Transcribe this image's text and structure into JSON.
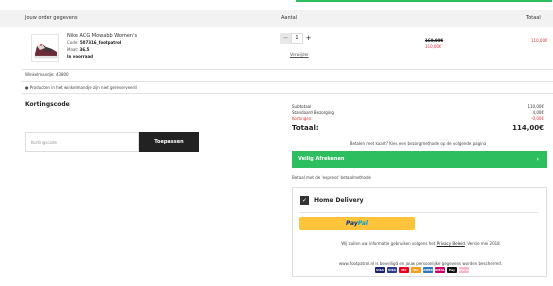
{
  "header": {
    "col_order": "Jouw order gegevens",
    "col_qty": "Aantal",
    "col_total": "Totaal"
  },
  "product": {
    "name": "Nike ACG Mowabb Women's",
    "code_label": "Code:",
    "code_value": "507316_footpatrol",
    "size_label": "Maat:",
    "size_value": "36.5",
    "stock": "In voorraad",
    "quantity": "1",
    "remove_label": "Verwijder",
    "price_old": "160,00€",
    "price_new": "110,00€",
    "price_total": "110,00€"
  },
  "cart": {
    "id_text": "Winkelmandje: 43800",
    "saved_text": "Producten in het winkelmandje zijn niet gereserveerd"
  },
  "coupon": {
    "title": "Kortingscode",
    "placeholder": "Kortingscode",
    "button": "Toepassen"
  },
  "summary": {
    "subtotal_label": "Subtotaal",
    "subtotal_value": "110,00€",
    "shipping_label": "Standaard Bezorging",
    "shipping_value": "4,00€",
    "discount_label": "Kortingen:",
    "discount_value": "-0,00€",
    "total_label": "Totaal:",
    "total_value": "114,00€",
    "pay_hint": "Betalen met kaart? Kies een bezorgmethode op de volgende pagina"
  },
  "checkout": {
    "button": "Veilig Afrekenen",
    "chevron": "›",
    "express_text": "Betaal met de 'express' betaalmethode"
  },
  "delivery": {
    "checkmark": "✓",
    "label": "Home Delivery",
    "paypal_part1": "Pay",
    "paypal_part2": "Pal",
    "privacy_text": "Wij zullen uw informatie gebruiken volgens het",
    "privacy_link": "Privacy Beleid",
    "privacy_suffix": "Versie mei 2018",
    "secure_text": "www.footpatrol.nl is beveiligd en jouw persoonlijke gegevens worden beschermd."
  },
  "payment_cards": [
    {
      "label": "VISA",
      "color": "#1a1f71"
    },
    {
      "label": "VISA",
      "color": "#2a3a8c"
    },
    {
      "label": "MC",
      "color": "#eb001b"
    },
    {
      "label": "MC",
      "color": "#f79e1b"
    },
    {
      "label": "AMEX",
      "color": "#2e77bc"
    },
    {
      "label": "iDEAL",
      "color": "#cc0066"
    },
    {
      "label": "Pay",
      "color": "#111111"
    },
    {
      "label": "Klarna",
      "color": "#ffb3c7"
    }
  ],
  "colors": {
    "accent_green": "#2dbe60",
    "price_red": "#dd3333",
    "paypal_yellow": "#ffc439"
  }
}
